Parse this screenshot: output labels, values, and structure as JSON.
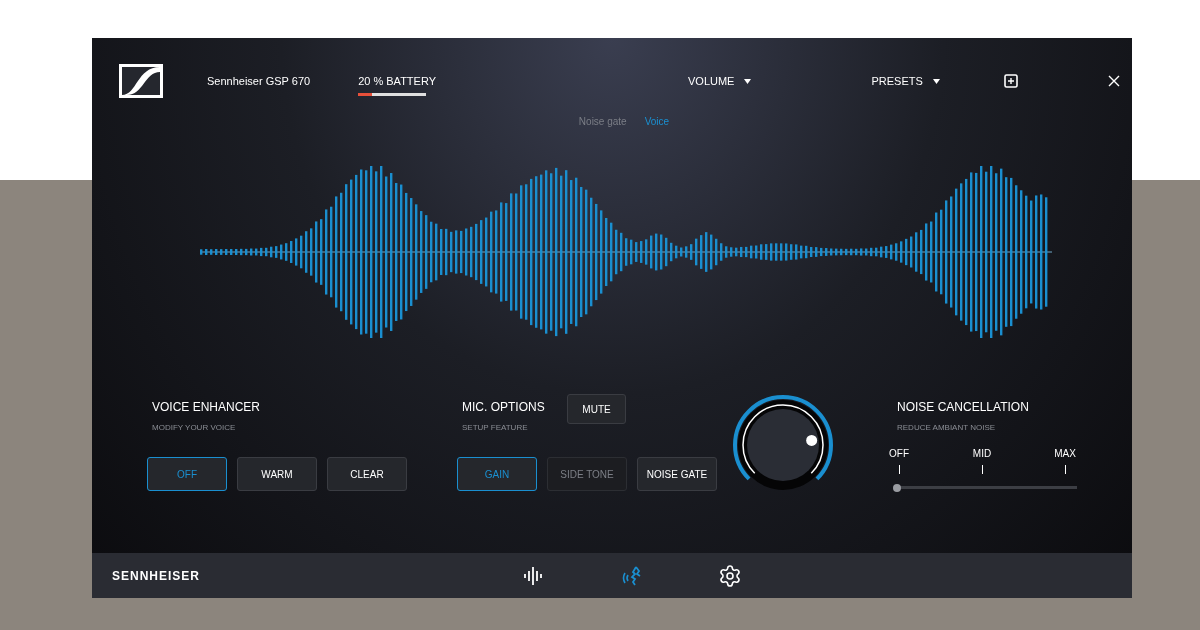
{
  "header": {
    "device_name": "Sennheiser GSP 670",
    "battery": {
      "label": "20 % BATTERY",
      "level": 0.2
    },
    "menus": [
      {
        "label": "VOLUME"
      },
      {
        "label": "PRESETS"
      }
    ]
  },
  "modes": [
    {
      "label": "Noise gate",
      "selected": false
    },
    {
      "label": "Voice",
      "selected": true
    }
  ],
  "voice_enhancer": {
    "title": "VOICE ENHANCER",
    "subtitle": "MODIFY YOUR VOICE",
    "buttons": [
      {
        "label": "OFF",
        "selected": true,
        "disabled": false
      },
      {
        "label": "WARM",
        "selected": false,
        "disabled": false
      },
      {
        "label": "CLEAR",
        "selected": false,
        "disabled": false
      }
    ]
  },
  "mic_options": {
    "title": "MIC. OPTIONS",
    "subtitle": "SETUP FEATURE",
    "mute": "MUTE",
    "buttons": [
      {
        "label": "GAIN",
        "selected": true,
        "disabled": false
      },
      {
        "label": "SIDE TONE",
        "selected": false,
        "disabled": true
      },
      {
        "label": "NOISE GATE",
        "selected": false,
        "disabled": false
      }
    ]
  },
  "knob": {
    "level": 0.8
  },
  "noise_cancellation": {
    "title": "NOISE CANCELLATION",
    "subtitle": "REDUCE AMBIANT NOISE",
    "ticks": [
      "OFF",
      "MID",
      "MAX"
    ],
    "level": 0
  },
  "footer": {
    "brand": "SENNHEISER",
    "nav": [
      {
        "kind": "equalizer",
        "selected": false
      },
      {
        "kind": "voice",
        "selected": true
      },
      {
        "kind": "settings",
        "selected": false
      }
    ]
  }
}
